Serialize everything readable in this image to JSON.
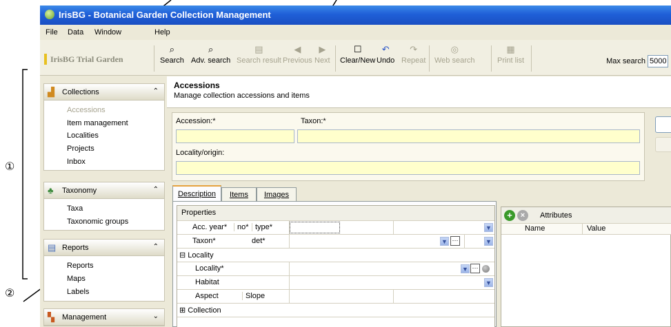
{
  "window": {
    "title": "IrisBG - Botanical Garden Collection Management"
  },
  "menu": [
    "File",
    "Data",
    "Window",
    "Help"
  ],
  "toolbar": {
    "garden": "IrisBG Trial Garden",
    "buttons": [
      {
        "label": "Search",
        "icon": "binoculars-icon",
        "enabled": true
      },
      {
        "label": "Adv. search",
        "icon": "binoculars-icon",
        "enabled": true
      },
      {
        "label": "Search result",
        "icon": "table-icon",
        "enabled": false
      },
      {
        "label": "Previous",
        "icon": "arrow-left-icon",
        "enabled": false
      },
      {
        "label": "Next",
        "icon": "arrow-right-icon",
        "enabled": false
      },
      {
        "label": "Clear/New",
        "icon": "new-window-icon",
        "enabled": true
      },
      {
        "label": "Undo",
        "icon": "undo-icon",
        "enabled": true
      },
      {
        "label": "Repeat",
        "icon": "repeat-icon",
        "enabled": false
      },
      {
        "label": "Web search",
        "icon": "web-icon",
        "enabled": false
      },
      {
        "label": "Print list",
        "icon": "printer-icon",
        "enabled": false
      }
    ],
    "max_search_label": "Max search",
    "max_search_value": "5000"
  },
  "sidebar": {
    "collections": {
      "title": "Collections",
      "items": [
        "Accessions",
        "Item management",
        "Localities",
        "Projects",
        "Inbox"
      ]
    },
    "taxonomy": {
      "title": "Taxonomy",
      "items": [
        "Taxa",
        "Taxonomic groups"
      ]
    },
    "reports": {
      "title": "Reports",
      "items": [
        "Reports",
        "Maps",
        "Labels"
      ]
    },
    "management": {
      "title": "Management"
    }
  },
  "main": {
    "title": "Accessions",
    "subtitle": "Manage collection accessions and items",
    "form": {
      "accession_label": "Accession:*",
      "taxon_label": "Taxon:*",
      "locality_label": "Locality/origin:"
    },
    "tabs": [
      "Description",
      "Items",
      "Images"
    ],
    "properties": {
      "title": "Properties",
      "acc_year": "Acc. year*",
      "no": "no*",
      "type": "type*",
      "taxon": "Taxon*",
      "det": "det*",
      "locality_section": "Locality",
      "locality": "Locality*",
      "habitat": "Habitat",
      "aspect": "Aspect",
      "slope": "Slope",
      "collection_section": "Collection"
    },
    "attributes": {
      "title": "Attributes",
      "col_name": "Name",
      "col_value": "Value"
    }
  },
  "annotations": {
    "one": "①",
    "two": "②"
  }
}
